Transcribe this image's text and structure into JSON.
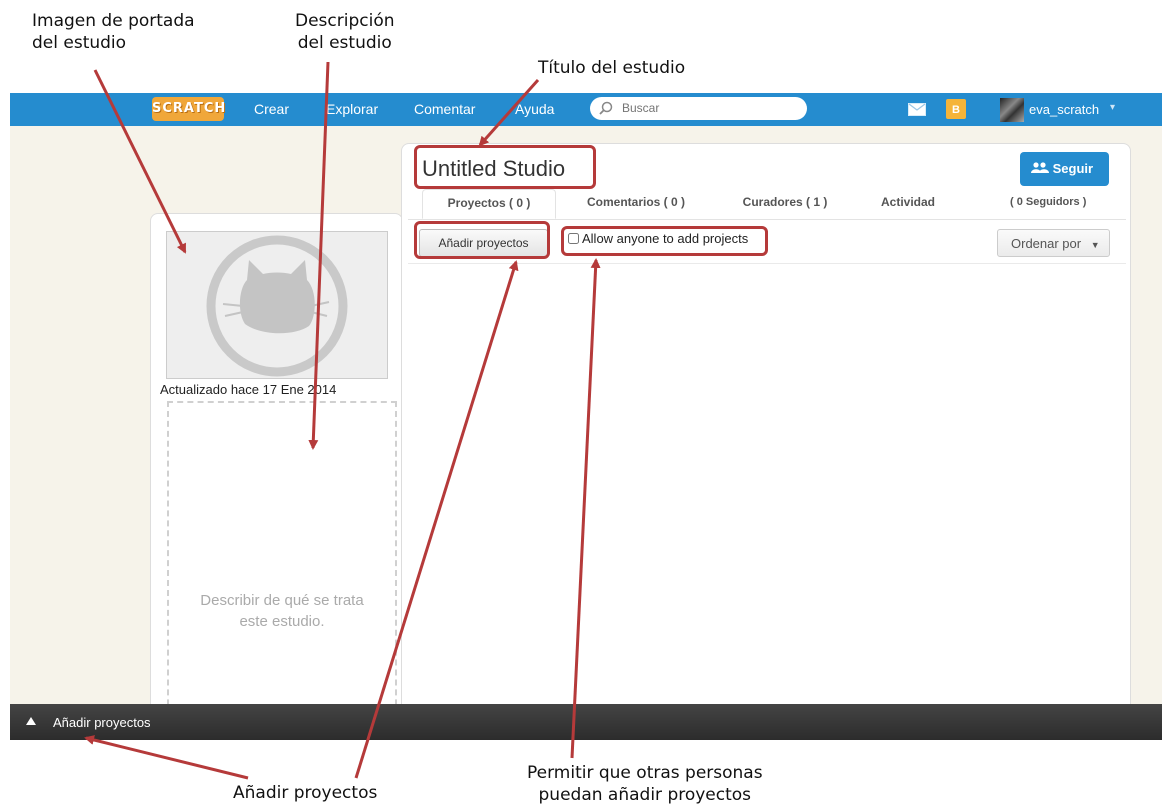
{
  "annotations": {
    "cover_image": "Imagen de portada\ndel estudio",
    "description": "Descripción\ndel estudio",
    "title": "Título del estudio",
    "add_projects": "Añadir proyectos",
    "allow_others": "Permitir que otras personas\npuedan añadir proyectos"
  },
  "navbar": {
    "logo": "SCRATCH",
    "links": [
      "Crear",
      "Explorar",
      "Comentar",
      "Ayuda"
    ],
    "search_placeholder": "Buscar",
    "username": "eva_scratch",
    "brand_color": "#258ccf"
  },
  "sidebar": {
    "updated": "Actualizado hace 17 Ene 2014",
    "description_placeholder": "Describir de qué se trata\neste estudio."
  },
  "studio": {
    "title": "Untitled Studio",
    "follow_label": "Seguir",
    "followers": "( 0 Seguidors )",
    "tabs": [
      "Proyectos ( 0 )",
      "Comentarios ( 0 )",
      "Curadores ( 1 )",
      "Actividad"
    ],
    "add_button": "Añadir proyectos",
    "allow_checkbox": "Allow anyone to add projects",
    "sort_label": "Ordenar por"
  },
  "tray": {
    "label": "Añadir proyectos"
  },
  "highlight_color": "#b53a3a"
}
